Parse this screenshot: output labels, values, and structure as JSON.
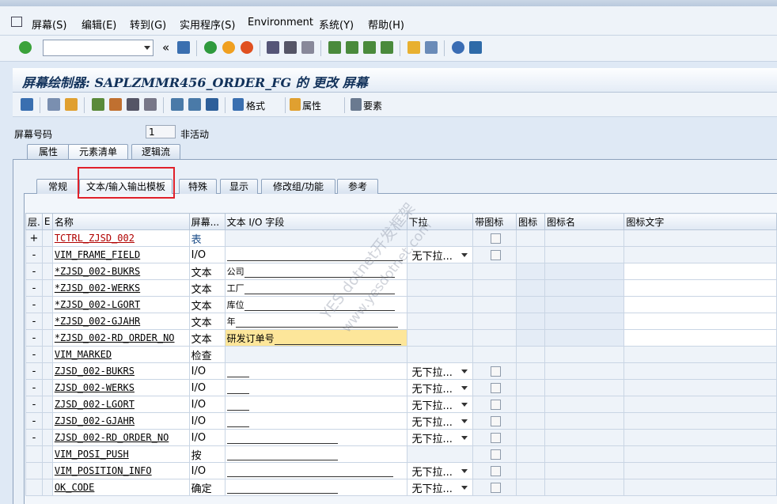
{
  "menu": {
    "items": [
      "屏幕(S)",
      "编辑(E)",
      "转到(G)",
      "实用程序(S)",
      "Environment",
      "系统(Y)",
      "帮助(H)"
    ]
  },
  "toolbar": {
    "command_field_value": "",
    "back_label": "«"
  },
  "title": "屏幕绘制器: SAPLZMMR456_ORDER_FG 的 更改 屏幕",
  "app_toolbar": {
    "format_label": "格式",
    "attributes_label": "属性",
    "elements_label": "要素"
  },
  "screen": {
    "number_label": "屏幕号码",
    "number_value": "1",
    "status": "非活动"
  },
  "outer_tabs": [
    "属性",
    "元素清单",
    "逻辑流"
  ],
  "inner_tabs": [
    "常规",
    "文本/输入输出模板",
    "特殊",
    "显示",
    "修改组/功能",
    "参考"
  ],
  "table": {
    "headers": [
      "层.",
      "E",
      "名称",
      "屏幕...",
      "文本 I/O 字段",
      "下拉",
      "带图标",
      "图标",
      "图标名",
      "图标文字"
    ],
    "rows": [
      {
        "lvl": "+",
        "name": "TCTRL_ZJSD_002",
        "type": "表",
        "text": "",
        "dropdown": "",
        "check": true,
        "style": "red"
      },
      {
        "lvl": "-",
        "name": "VIM_FRAME_FIELD",
        "type": "I/O",
        "text": "",
        "dropdown": "无下拉...",
        "check": true,
        "style": "long"
      },
      {
        "lvl": "-",
        "name": "*ZJSD_002-BUKRS",
        "type": "文本",
        "text": "公司",
        "dropdown": "",
        "check": false,
        "style": "text"
      },
      {
        "lvl": "-",
        "name": "*ZJSD_002-WERKS",
        "type": "文本",
        "text": "工厂",
        "dropdown": "",
        "check": false,
        "style": "text"
      },
      {
        "lvl": "-",
        "name": "*ZJSD_002-LGORT",
        "type": "文本",
        "text": "库位",
        "dropdown": "",
        "check": false,
        "style": "text"
      },
      {
        "lvl": "-",
        "name": "*ZJSD_002-GJAHR",
        "type": "文本",
        "text": "年",
        "dropdown": "",
        "check": false,
        "style": "text"
      },
      {
        "lvl": "-",
        "name": "*ZJSD_002-RD_ORDER_NO",
        "type": "文本",
        "text": "研发订单号",
        "dropdown": "",
        "check": false,
        "style": "yellow"
      },
      {
        "lvl": "-",
        "name": "VIM_MARKED",
        "type": "检查",
        "text": "",
        "dropdown": "",
        "check": false,
        "style": "none"
      },
      {
        "lvl": "-",
        "name": "ZJSD_002-BUKRS",
        "type": "I/O",
        "text": "",
        "dropdown": "无下拉...",
        "check": true,
        "style": "short"
      },
      {
        "lvl": "-",
        "name": "ZJSD_002-WERKS",
        "type": "I/O",
        "text": "",
        "dropdown": "无下拉...",
        "check": true,
        "style": "short"
      },
      {
        "lvl": "-",
        "name": "ZJSD_002-LGORT",
        "type": "I/O",
        "text": "",
        "dropdown": "无下拉...",
        "check": true,
        "style": "short"
      },
      {
        "lvl": "-",
        "name": "ZJSD_002-GJAHR",
        "type": "I/O",
        "text": "",
        "dropdown": "无下拉...",
        "check": true,
        "style": "short"
      },
      {
        "lvl": "-",
        "name": "ZJSD_002-RD_ORDER_NO",
        "type": "I/O",
        "text": "",
        "dropdown": "无下拉...",
        "check": true,
        "style": "mid"
      },
      {
        "lvl": "",
        "name": "VIM_POSI_PUSH",
        "type": "按",
        "text": "",
        "dropdown": "",
        "check": true,
        "style": "mid"
      },
      {
        "lvl": "",
        "name": "VIM_POSITION_INFO",
        "type": "I/O",
        "text": "",
        "dropdown": "无下拉...",
        "check": true,
        "style": "long2"
      },
      {
        "lvl": "",
        "name": "OK_CODE",
        "type": "确定",
        "text": "",
        "dropdown": "无下拉...",
        "check": true,
        "style": "mid"
      }
    ]
  },
  "watermark": [
    "YES dotnet开发框架",
    "www.yesdotnet.com"
  ],
  "colors": {
    "title_text": "#11315a",
    "highlight_box": "#e0202a",
    "link_red": "#b00000",
    "field_yellow": "#fde69a"
  }
}
